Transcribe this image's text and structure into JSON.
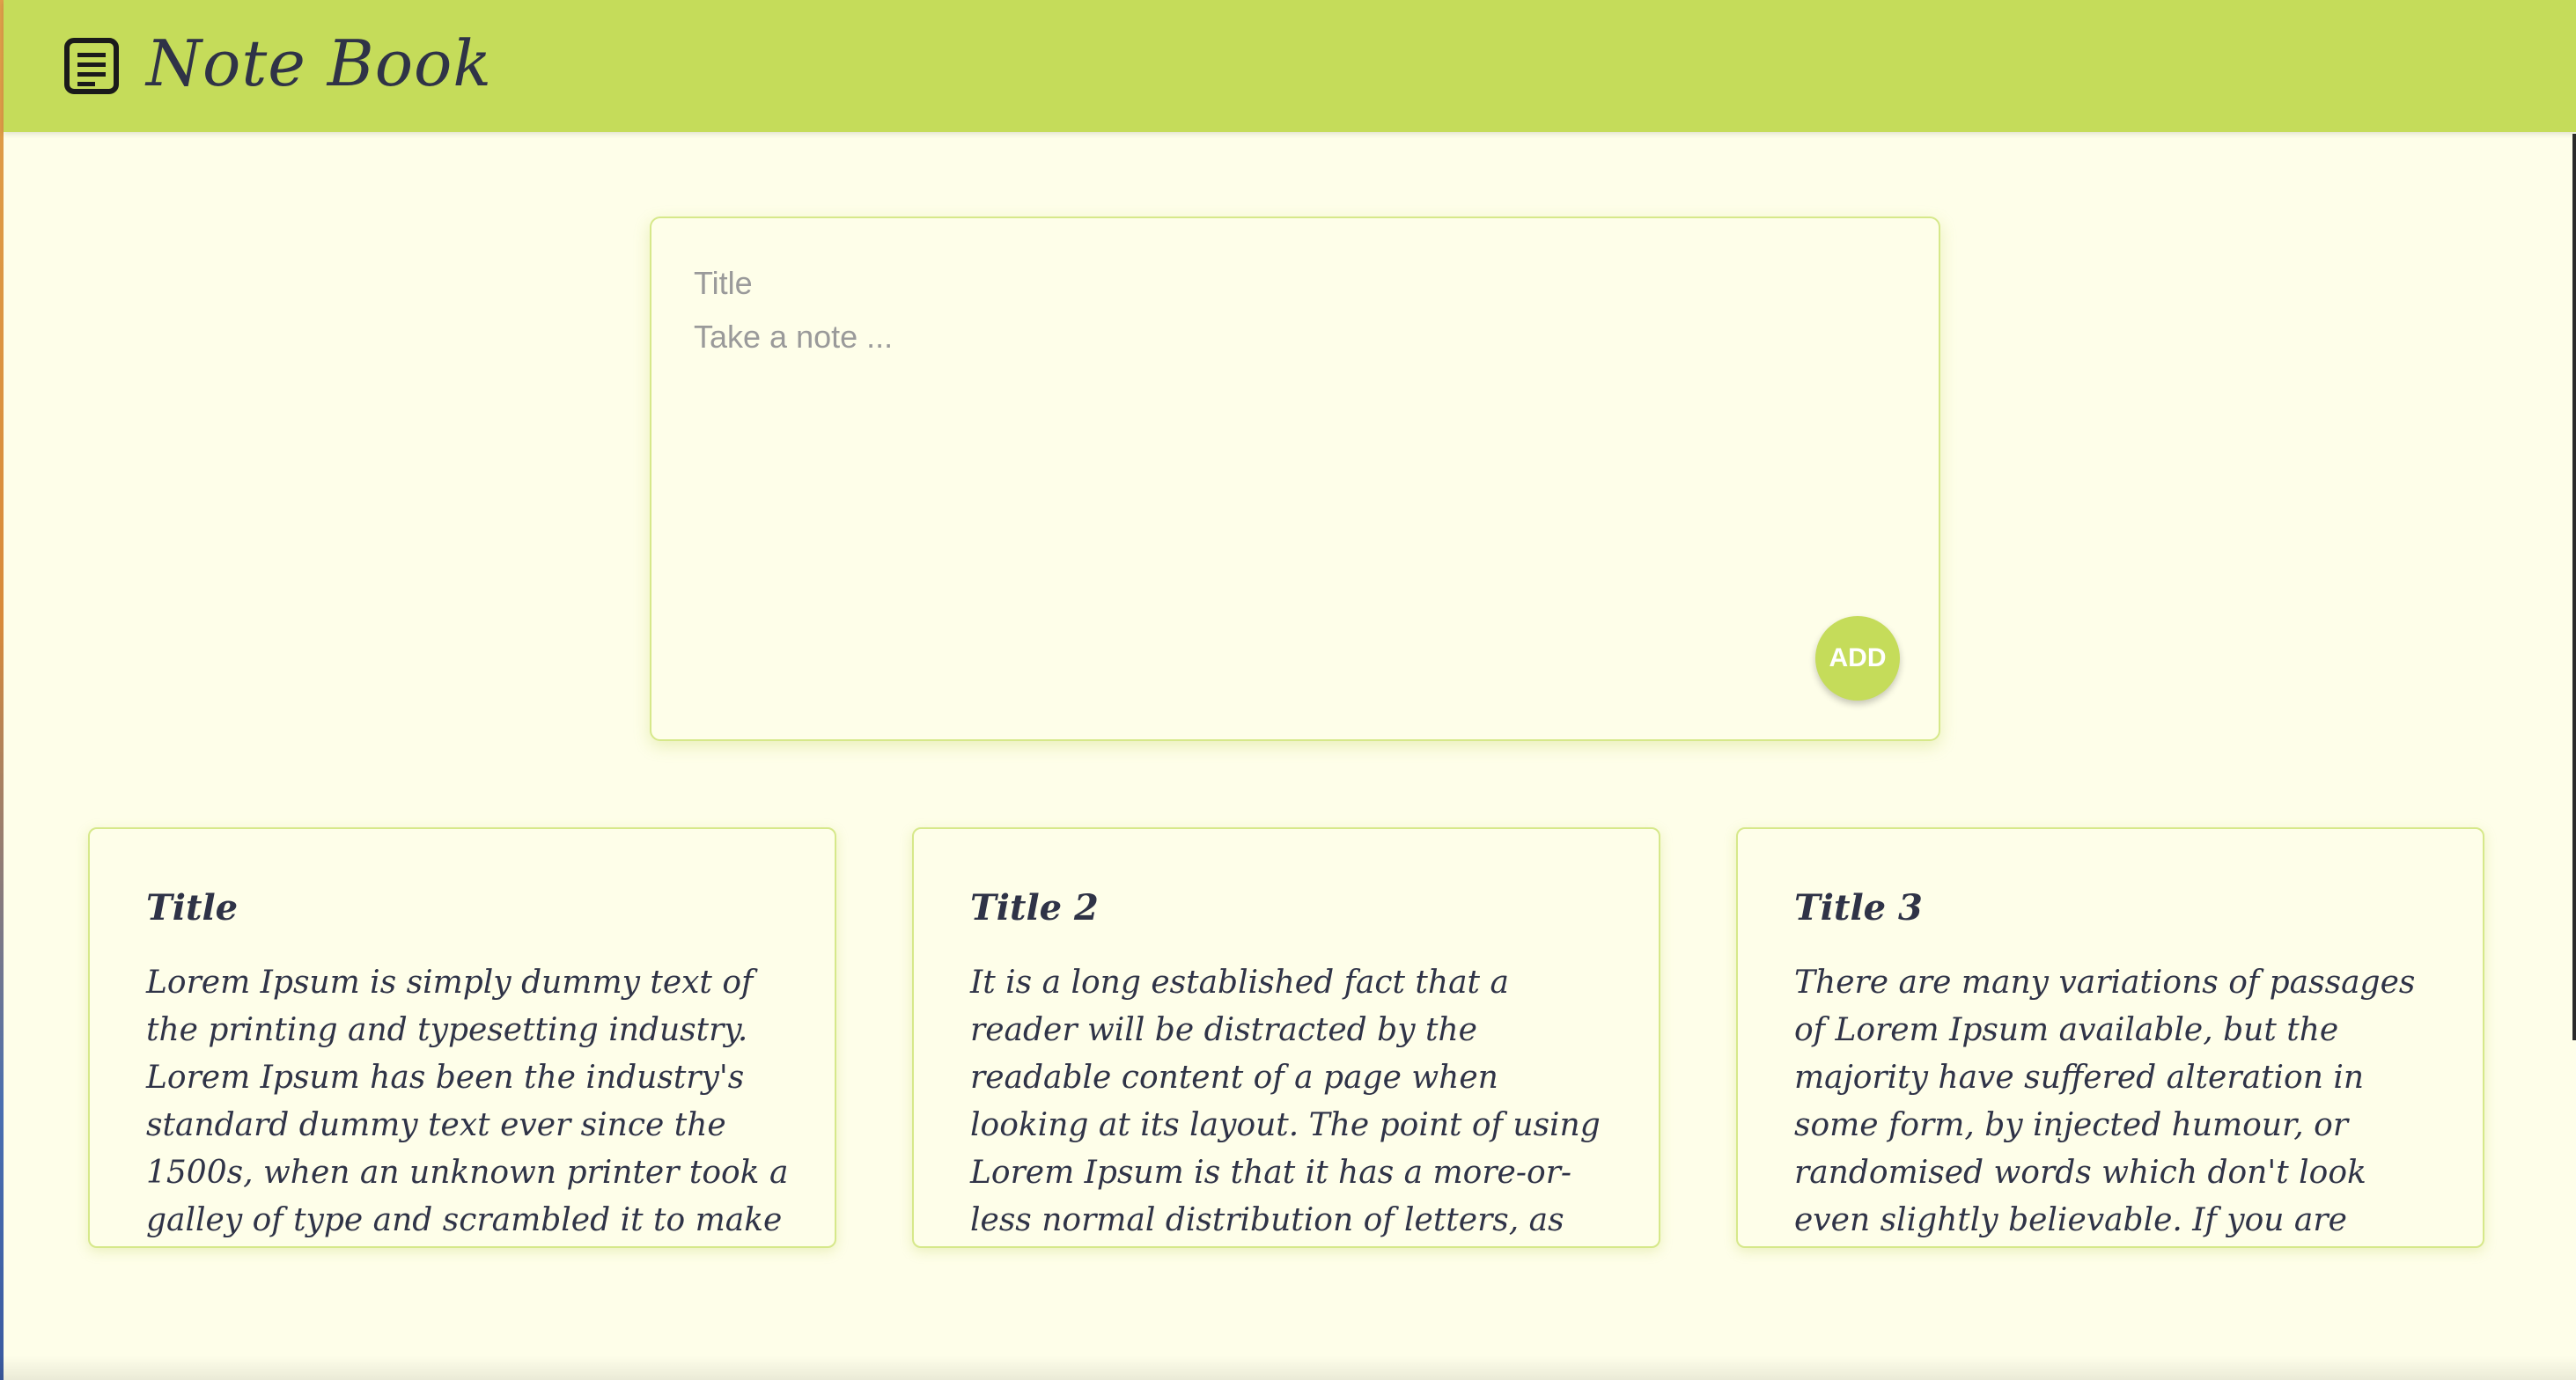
{
  "header": {
    "app_title": "Note Book",
    "logo_icon": "notebook-icon",
    "background_color": "#c5dc5a"
  },
  "composer": {
    "title_placeholder": "Title",
    "content_placeholder": "Take a note ...",
    "add_label": "ADD"
  },
  "notes": [
    {
      "title": "Title",
      "content": "Lorem Ipsum is simply dummy text of the printing and typesetting industry. Lorem Ipsum has been the industry's standard dummy text ever since the 1500s, when an unknown printer took a galley of type and scrambled it to make"
    },
    {
      "title": "Title 2",
      "content": "It is a long established fact that a reader will be distracted by the readable content of a page when looking at its layout. The point of using Lorem Ipsum is that it has a more-or-less normal distribution of letters, as opposed to"
    },
    {
      "title": "Title 3",
      "content": "There are many variations of passages of Lorem Ipsum available, but the majority have suffered alteration in some form, by injected humour, or randomised words which don't look even slightly believable. If you are going to use"
    }
  ],
  "colors": {
    "accent": "#c5dc5a",
    "page_background": "#fefee9",
    "text": "#2f3347",
    "card_border": "#d6e88a"
  }
}
